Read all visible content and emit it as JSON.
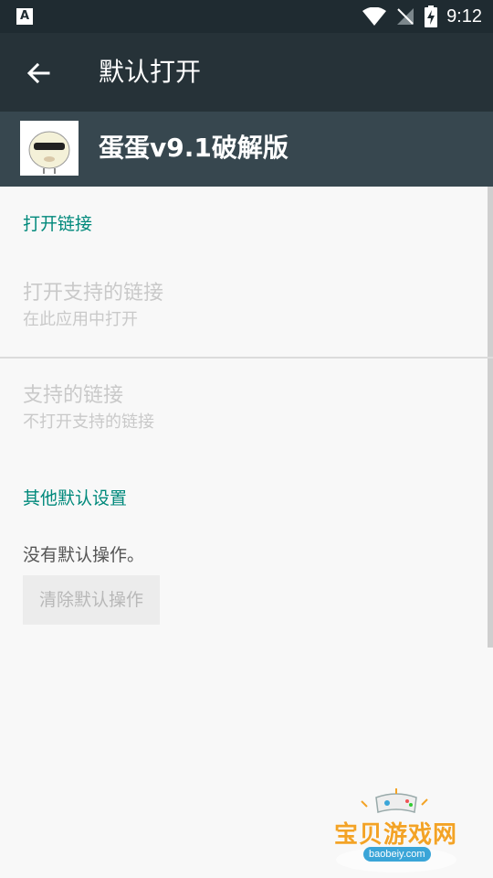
{
  "status_bar": {
    "time": "9:12",
    "left_badge": "A"
  },
  "app_bar": {
    "title": "默认打开"
  },
  "app_header": {
    "name": "蛋蛋v9.1破解版"
  },
  "sections": {
    "open_links": {
      "header": "打开链接",
      "open_supported": {
        "title": "打开支持的链接",
        "summary": "在此应用中打开"
      },
      "supported_links": {
        "title": "支持的链接",
        "summary": "不打开支持的链接"
      }
    },
    "other_defaults": {
      "header": "其他默认设置",
      "no_defaults_text": "没有默认操作。",
      "clear_button": "清除默认操作"
    }
  },
  "watermark": {
    "text": "宝贝游戏网",
    "url": "baobeiy.com"
  },
  "colors": {
    "status_bar": "#1f2b31",
    "app_bar": "#263238",
    "app_header": "#37474f",
    "accent": "#00897b",
    "background": "#f8f8f8"
  }
}
